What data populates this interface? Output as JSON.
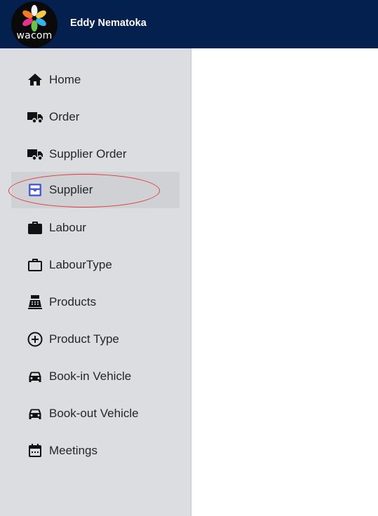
{
  "header": {
    "logo_text": "wacom",
    "user_name": "Eddy Nematoka",
    "background_color": "#04204f"
  },
  "sidebar": {
    "items": [
      {
        "label": "Home",
        "icon": "home-icon"
      },
      {
        "label": "Order",
        "icon": "truck-icon"
      },
      {
        "label": "Supplier Order",
        "icon": "truck-icon"
      },
      {
        "label": "Supplier",
        "icon": "inbox-tray-icon",
        "active": true,
        "accent": "#4a5fd1"
      },
      {
        "label": "Labour",
        "icon": "briefcase-icon"
      },
      {
        "label": "LabourType",
        "icon": "briefcase-outline-icon"
      },
      {
        "label": "Products",
        "icon": "cash-register-icon"
      },
      {
        "label": "Product Type",
        "icon": "add-circle-icon"
      },
      {
        "label": "Book-in Vehicle",
        "icon": "car-icon"
      },
      {
        "label": "Book-out Vehicle",
        "icon": "car-icon"
      },
      {
        "label": "Meetings",
        "icon": "calendar-icon"
      }
    ]
  },
  "annotation": {
    "color": "#e03a3a",
    "target": "Supplier"
  }
}
